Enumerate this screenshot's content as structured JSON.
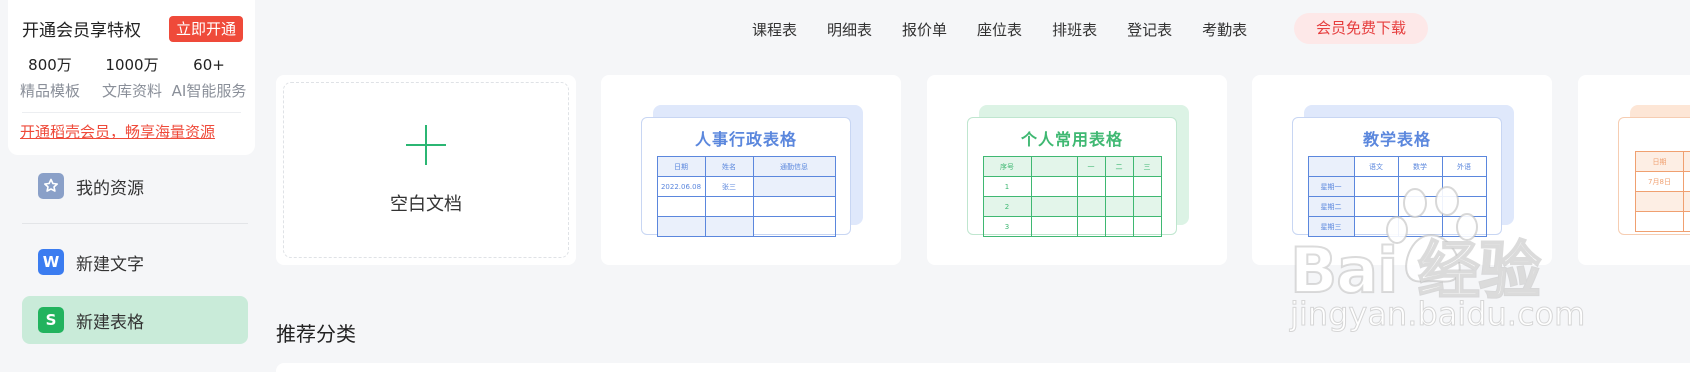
{
  "vip": {
    "title": "开通会员享特权",
    "button": "立即开通",
    "stats": [
      {
        "num": "800万",
        "label": "精品模板"
      },
      {
        "num": "1000万",
        "label": "文库资料"
      },
      {
        "num": "60+",
        "label": "AI智能服务"
      }
    ],
    "link": "开通稻壳会员，畅享海量资源"
  },
  "sidebar": {
    "items": [
      {
        "label": "我的资源",
        "icon": "star-icon",
        "color": "#8aa0c8"
      },
      {
        "label": "新建文字",
        "icon": "w-doc-icon",
        "color": "#3b7cf0"
      },
      {
        "label": "新建表格",
        "icon": "s-sheet-icon",
        "color": "#22b35e"
      }
    ]
  },
  "topnav": {
    "tabs": [
      "课程表",
      "明细表",
      "报价单",
      "座位表",
      "排班表",
      "登记表",
      "考勤表"
    ],
    "vip_download": "会员免费下载"
  },
  "blank": {
    "label": "空白文档"
  },
  "templates": [
    {
      "title": "人事行政表格",
      "color": "#5b87dd",
      "rows": [
        [
          "日期",
          "姓名",
          "通勤信息"
        ],
        [
          "2022.06.08",
          "张三",
          ""
        ],
        [
          "",
          "",
          ""
        ],
        [
          "",
          "",
          ""
        ]
      ]
    },
    {
      "title": "个人常用表格",
      "color": "#3fb872",
      "rows": [
        [
          "序号",
          "",
          "一",
          "二",
          "三"
        ],
        [
          "1",
          "",
          "",
          "",
          ""
        ],
        [
          "2",
          "",
          "",
          "",
          ""
        ],
        [
          "3",
          "",
          "",
          "",
          ""
        ]
      ]
    },
    {
      "title": "教学表格",
      "color": "#5b87dd",
      "rows": [
        [
          "",
          "语文",
          "数学",
          "外语"
        ],
        [
          "星期一",
          "",
          "",
          ""
        ],
        [
          "星期二",
          "",
          "",
          ""
        ],
        [
          "星期三",
          "",
          "",
          ""
        ]
      ]
    },
    {
      "title": "",
      "color": "#f0a070",
      "rows": [
        [
          "日期"
        ],
        [
          "7月8日"
        ],
        [
          ""
        ],
        [
          ""
        ]
      ]
    }
  ],
  "section": {
    "title": "推荐分类"
  },
  "watermark": {
    "main": "Bai 经验",
    "sub": "jingyan.baidu.com"
  }
}
